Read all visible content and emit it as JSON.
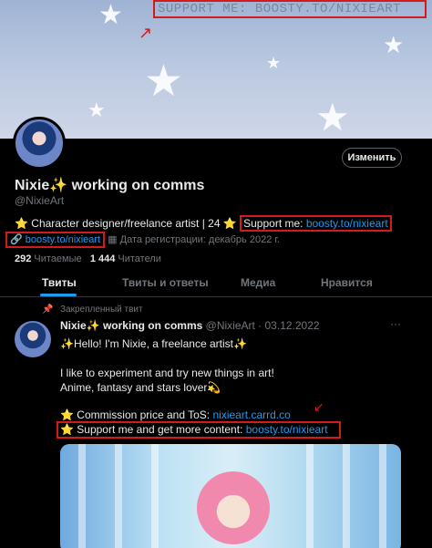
{
  "banner": {
    "promo_text": "SUPPORT ME: BOOSTY.TO/NIXIEART",
    "arrow_glyph": "↗"
  },
  "profile": {
    "edit_label": "Изменить",
    "name": "Nixie✨ working on comms",
    "handle": "@NixieArt",
    "bio_prefix": "⭐ Character designer/freelance artist | 24 ⭐",
    "bio_support_label": "Support me: ",
    "bio_support_link": "boosty.to/nixieart",
    "meta_link_icon": "link-icon",
    "meta_link": "boosty.to/nixieart",
    "meta_calendar_icon": "calendar-icon",
    "meta_joined": "Дата регистрации: декабрь 2022 г.",
    "following_count": "292",
    "following_label": "Читаемые",
    "followers_count": "1 444",
    "followers_label": "Читатели"
  },
  "tabs": [
    {
      "label": "Твиты",
      "active": true
    },
    {
      "label": "Твиты и ответы",
      "active": false
    },
    {
      "label": "Медиа",
      "active": false
    },
    {
      "label": "Нравится",
      "active": false
    }
  ],
  "tweet": {
    "pinned_label": "Закрепленный твит",
    "author_name": "Nixie✨ working on comms",
    "author_handle_date": "@NixieArt · 03.12.2022",
    "lines": [
      "✨Hello! I'm Nixie, a freelance artist✨",
      "I like to experiment and try new things in art!",
      "Anime, fantasy and stars lover💫"
    ],
    "commission_prefix": "⭐ Commission price and ToS: ",
    "commission_link": "nixieart.carrd.co",
    "support_prefix": "⭐ Support me and get more content: ",
    "support_link": "boosty.to/nixieart",
    "more_glyph": "···"
  },
  "colors": {
    "accent": "#1d9bf0",
    "highlight_box": "#d21c1c",
    "background": "#000000",
    "muted_text": "#71767b"
  }
}
